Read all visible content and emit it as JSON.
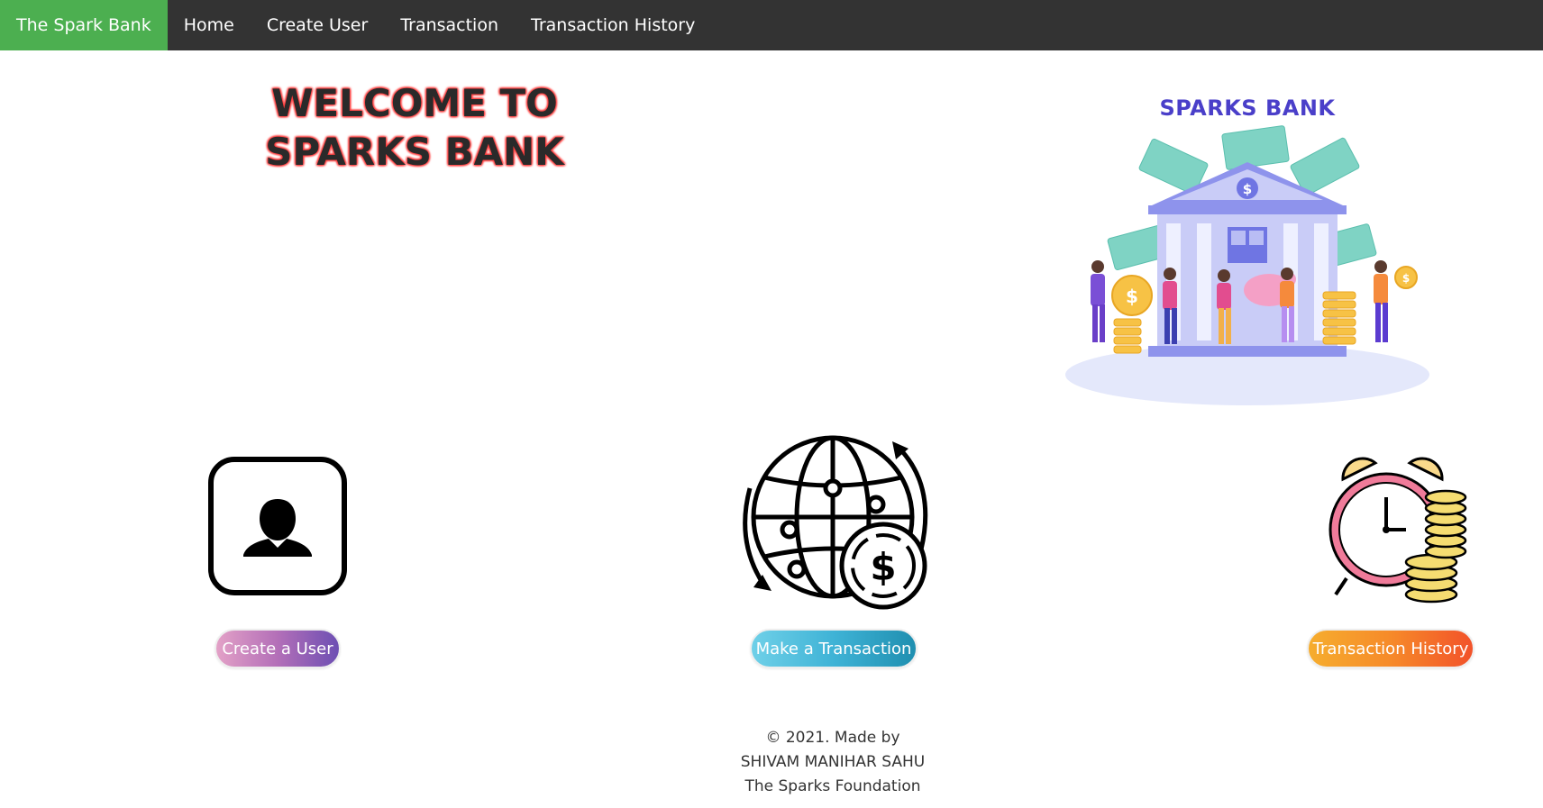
{
  "navbar": {
    "brand": "The Spark Bank",
    "items": [
      {
        "label": "Home"
      },
      {
        "label": "Create User"
      },
      {
        "label": "Transaction"
      },
      {
        "label": "Transaction History"
      }
    ],
    "brand_color": "#4caf50",
    "background_color": "#333333"
  },
  "hero": {
    "welcome_line1": "WELCOME TO",
    "welcome_line2": "SPARKS BANK",
    "illustration_title": "SPARKS BANK"
  },
  "features": [
    {
      "icon": "user-profile-icon",
      "button_label": "Create a User"
    },
    {
      "icon": "globe-dollar-icon",
      "button_label": "Make a Transaction"
    },
    {
      "icon": "alarm-clock-coins-icon",
      "button_label": "Transaction History"
    }
  ],
  "footer": {
    "line1": "© 2021. Made by",
    "line2": "SHIVAM MANIHAR SAHU",
    "line3": "The Sparks Foundation"
  }
}
